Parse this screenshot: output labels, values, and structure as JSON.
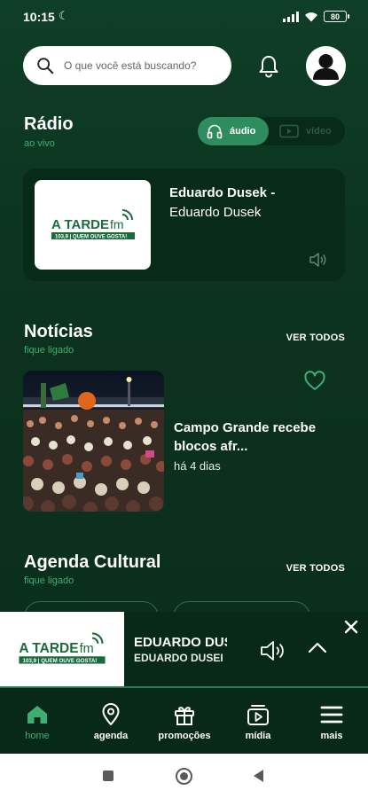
{
  "status": {
    "time": "10:15",
    "battery": "80"
  },
  "search": {
    "placeholder": "O que você está buscando?"
  },
  "radio": {
    "title": "Rádio",
    "subtitle": "ao vivo",
    "toggle": {
      "audio_label": "áudio",
      "video_label": "vídeo",
      "selected": "áudio"
    },
    "now_playing": {
      "line1": "Eduardo Dusek -",
      "line2": "Eduardo Dusek"
    },
    "logo": {
      "brand": "A TARDE",
      "suffix": "fm",
      "tagline": "103,9 | QUEM OUVE GOSTA!"
    }
  },
  "news": {
    "title": "Notícias",
    "subtitle": "fique ligado",
    "see_all": "VER TODOS",
    "item": {
      "title": "Campo Grande recebe blocos afr...",
      "time": "há 4 dias"
    }
  },
  "agenda": {
    "title": "Agenda Cultural",
    "subtitle": "fique ligado",
    "see_all": "VER TODOS"
  },
  "player": {
    "title": "EDUARDO DUSEK",
    "artist": "EDUARDO DUSEK"
  },
  "nav": {
    "items": [
      {
        "label": "home",
        "icon": "home-icon",
        "active": true
      },
      {
        "label": "agenda",
        "icon": "location-pin-icon",
        "active": false
      },
      {
        "label": "promoções",
        "icon": "gift-icon",
        "active": false
      },
      {
        "label": "mídia",
        "icon": "media-play-icon",
        "active": false
      },
      {
        "label": "mais",
        "icon": "menu-icon",
        "active": false
      }
    ]
  },
  "colors": {
    "accent": "#3fae72",
    "brand_green": "#1a6b3c",
    "background": "#0c3420"
  }
}
